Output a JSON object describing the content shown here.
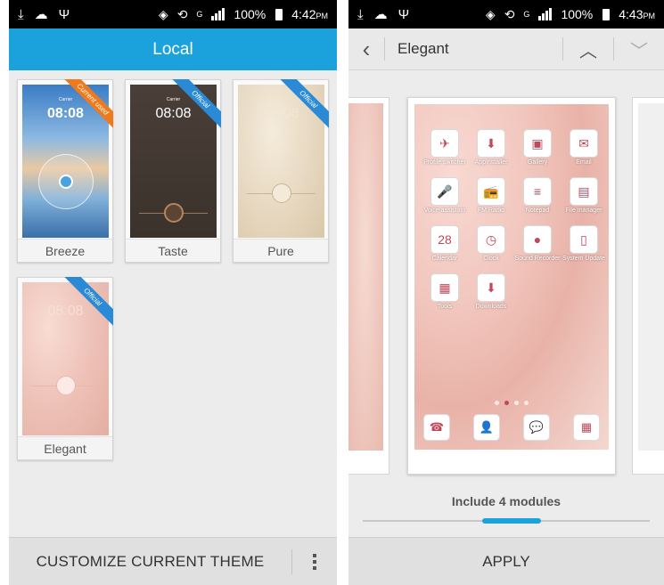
{
  "left": {
    "status": {
      "time": "4:42",
      "ampm": "PM",
      "battery": "100%",
      "network": "G"
    },
    "header_title": "Local",
    "themes": [
      {
        "label": "Breeze",
        "badge": "Current used",
        "badge_color": "#ef7a1c",
        "clock": "08:08"
      },
      {
        "label": "Taste",
        "badge": "Official",
        "badge_color": "#2a8ad6",
        "clock": "08:08"
      },
      {
        "label": "Pure",
        "badge": "Official",
        "badge_color": "#2a8ad6",
        "clock": "08:08"
      },
      {
        "label": "Elegant",
        "badge": "Official",
        "badge_color": "#2a8ad6",
        "clock": "08:08"
      }
    ],
    "footer": {
      "customize": "CUSTOMIZE CURRENT THEME",
      "more_icon": "overflow-menu-icon"
    }
  },
  "right": {
    "status": {
      "time": "4:43",
      "ampm": "PM",
      "battery": "100%",
      "network": "G"
    },
    "header": {
      "title": "Elegant",
      "back_icon": "chevron-left-icon",
      "up_icon": "chevron-up-icon",
      "down_icon": "chevron-down-icon"
    },
    "apps": [
      {
        "name": "Profile switcher",
        "icon": "✈"
      },
      {
        "name": "AppInstaller",
        "icon": "⬇"
      },
      {
        "name": "Gallery",
        "icon": "▣"
      },
      {
        "name": "Email",
        "icon": "✉"
      },
      {
        "name": "Voice assistant",
        "icon": "🎤"
      },
      {
        "name": "FM Radio",
        "icon": "📻"
      },
      {
        "name": "Notepad",
        "icon": "≡"
      },
      {
        "name": "File manager",
        "icon": "▤"
      },
      {
        "name": "Calendar",
        "icon": "28"
      },
      {
        "name": "Clock",
        "icon": "◷"
      },
      {
        "name": "Sound Recorder",
        "icon": "●"
      },
      {
        "name": "System Update",
        "icon": "▯"
      },
      {
        "name": "Tools",
        "icon": "▦"
      },
      {
        "name": "Downloads",
        "icon": "⬇"
      }
    ],
    "dock": [
      "☎",
      "👤",
      "💬",
      "▦"
    ],
    "modules_text": "Include 4 modules",
    "apply": "APPLY",
    "accent": "#1ba1dc"
  }
}
